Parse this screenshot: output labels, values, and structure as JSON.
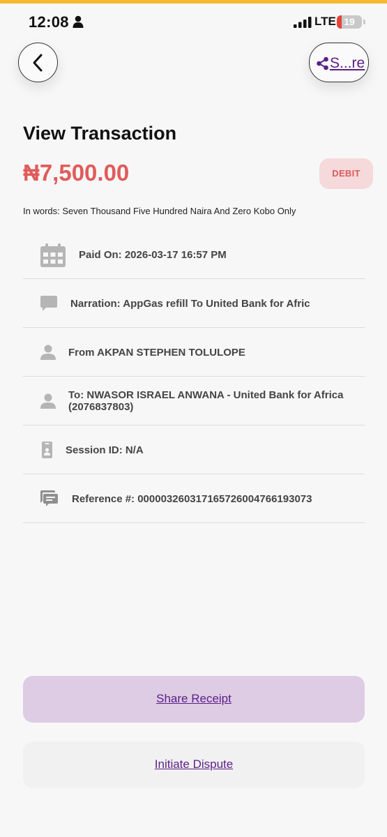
{
  "colors": {
    "accent_top": "#f7b92f",
    "amount": "#e15b5b",
    "badge_bg": "#f6d9da",
    "link_purple": "#5b1e86",
    "primary_button_bg": "#ddcce4",
    "icon_gray": "#b5b5b5"
  },
  "status_bar": {
    "time": "12:08",
    "network": "LTE",
    "battery_level": "19",
    "battery_fraction": 0.19
  },
  "header": {
    "back_icon": "chevron-left-icon",
    "share_icon": "share-icon",
    "share_label": "S...re"
  },
  "transaction": {
    "title": "View Transaction",
    "amount": "₦7,500.00",
    "type_badge": "DEBIT",
    "amount_in_words": "In words: Seven Thousand Five Hundred Naira And Zero Kobo Only"
  },
  "details": [
    {
      "icon": "calendar-icon",
      "text": "Paid On: 2026-03-17 16:57 PM"
    },
    {
      "icon": "comment-icon",
      "text": "Narration: AppGas refill To United Bank for Afric"
    },
    {
      "icon": "person-icon",
      "text": "From AKPAN STEPHEN TOLULOPE"
    },
    {
      "icon": "person-icon",
      "text": "To: NWASOR ISRAEL ANWANA  - United Bank for Africa  (2076837803)"
    },
    {
      "icon": "id-badge-icon",
      "text": "Session ID: N/A"
    },
    {
      "icon": "reference-chat-icon",
      "text": "Reference #: 000003260317165726004766193073"
    }
  ],
  "actions": {
    "share_receipt": "Share Receipt",
    "initiate_dispute": "Initiate Dispute"
  }
}
